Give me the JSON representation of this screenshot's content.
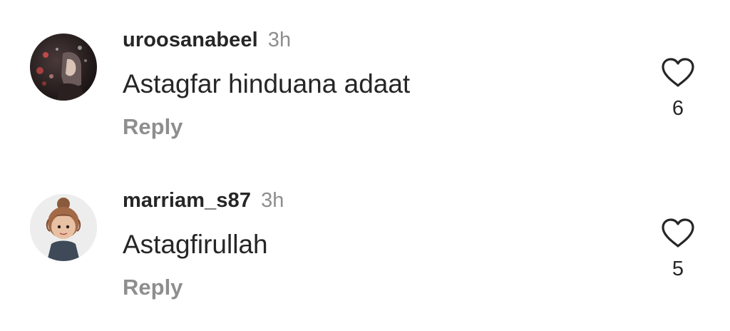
{
  "comments": [
    {
      "username": "uroosanabeel",
      "time": "3h",
      "text": "Astagfar hinduana adaat",
      "reply_label": "Reply",
      "likes": "6",
      "avatar_icon": "profile-photo-night-girl"
    },
    {
      "username": "marriam_s87",
      "time": "3h",
      "text": "Astagfirullah",
      "reply_label": "Reply",
      "likes": "5",
      "avatar_icon": "profile-photo-cartoon-girl"
    }
  ],
  "icons": {
    "like": "heart-outline-icon"
  },
  "colors": {
    "text": "#262626",
    "secondary": "#8e8e8e",
    "background": "#ffffff"
  }
}
